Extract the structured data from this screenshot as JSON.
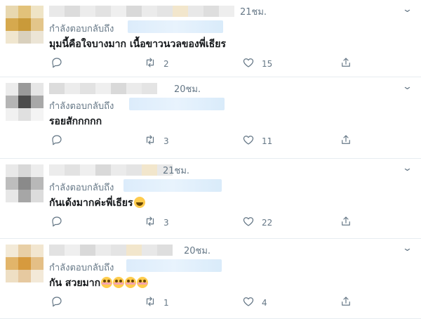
{
  "tweets": [
    {
      "time": "21ชม.",
      "reply_label": "กำลังตอบกลับถึง",
      "text": "มุมนี้คือใจบางมาก เนื้อขาวนวลของพี่เธียร",
      "emoji": [],
      "retweets": "2",
      "likes": "15",
      "avatar_colors": [
        "#e8d8b0",
        "#e2c27a",
        "#efe4c6",
        "#d6a94e",
        "#c99a3a",
        "#e3c58a",
        "#f0e6cf",
        "#d9d0bd",
        "#ece5d6"
      ]
    },
    {
      "time": "20ชม.",
      "reply_label": "กำลังตอบกลับถึง",
      "text": "รอยสักกกกก",
      "emoji": [],
      "retweets": "3",
      "likes": "11",
      "avatar_colors": [
        "#ececec",
        "#9a9a9a",
        "#e6e6e6",
        "#b5b5b5",
        "#4c4c4c",
        "#a8a8a8",
        "#f1f1f1",
        "#e0e0e0",
        "#f4f4f4"
      ]
    },
    {
      "time": "21ชม.",
      "reply_label": "กำลังตอบกลับถึง",
      "text": "กันเด้งมากค่ะพี่เธียร",
      "emoji": [
        "laugh"
      ],
      "retweets": "3",
      "likes": "22",
      "avatar_colors": [
        "#e9e9e9",
        "#d8d8d8",
        "#ededed",
        "#bdbdbd",
        "#8a8a8a",
        "#b8b8b8",
        "#e7e7e7",
        "#a6a6a6",
        "#dcdcdc"
      ]
    },
    {
      "time": "20ชม.",
      "reply_label": "กำลังตอบกลับถึง",
      "text": "กัน สวยมาก",
      "emoji": [
        "flush",
        "flush",
        "flush",
        "flush"
      ],
      "retweets": "1",
      "likes": "4",
      "avatar_colors": [
        "#f3ead8",
        "#e8cfa6",
        "#f2e6d0",
        "#e2b56a",
        "#d69a3e",
        "#e4bf86",
        "#eedfc4",
        "#e6c9a0",
        "#f3e9d8"
      ]
    }
  ],
  "icons": {
    "reply": "reply-icon",
    "retweet": "retweet-icon",
    "like": "heart-icon",
    "share": "share-icon",
    "menu": "chevron-down-icon"
  },
  "colors": {
    "muted": "#657786",
    "text": "#14171a",
    "divider": "#e6ecf0"
  }
}
